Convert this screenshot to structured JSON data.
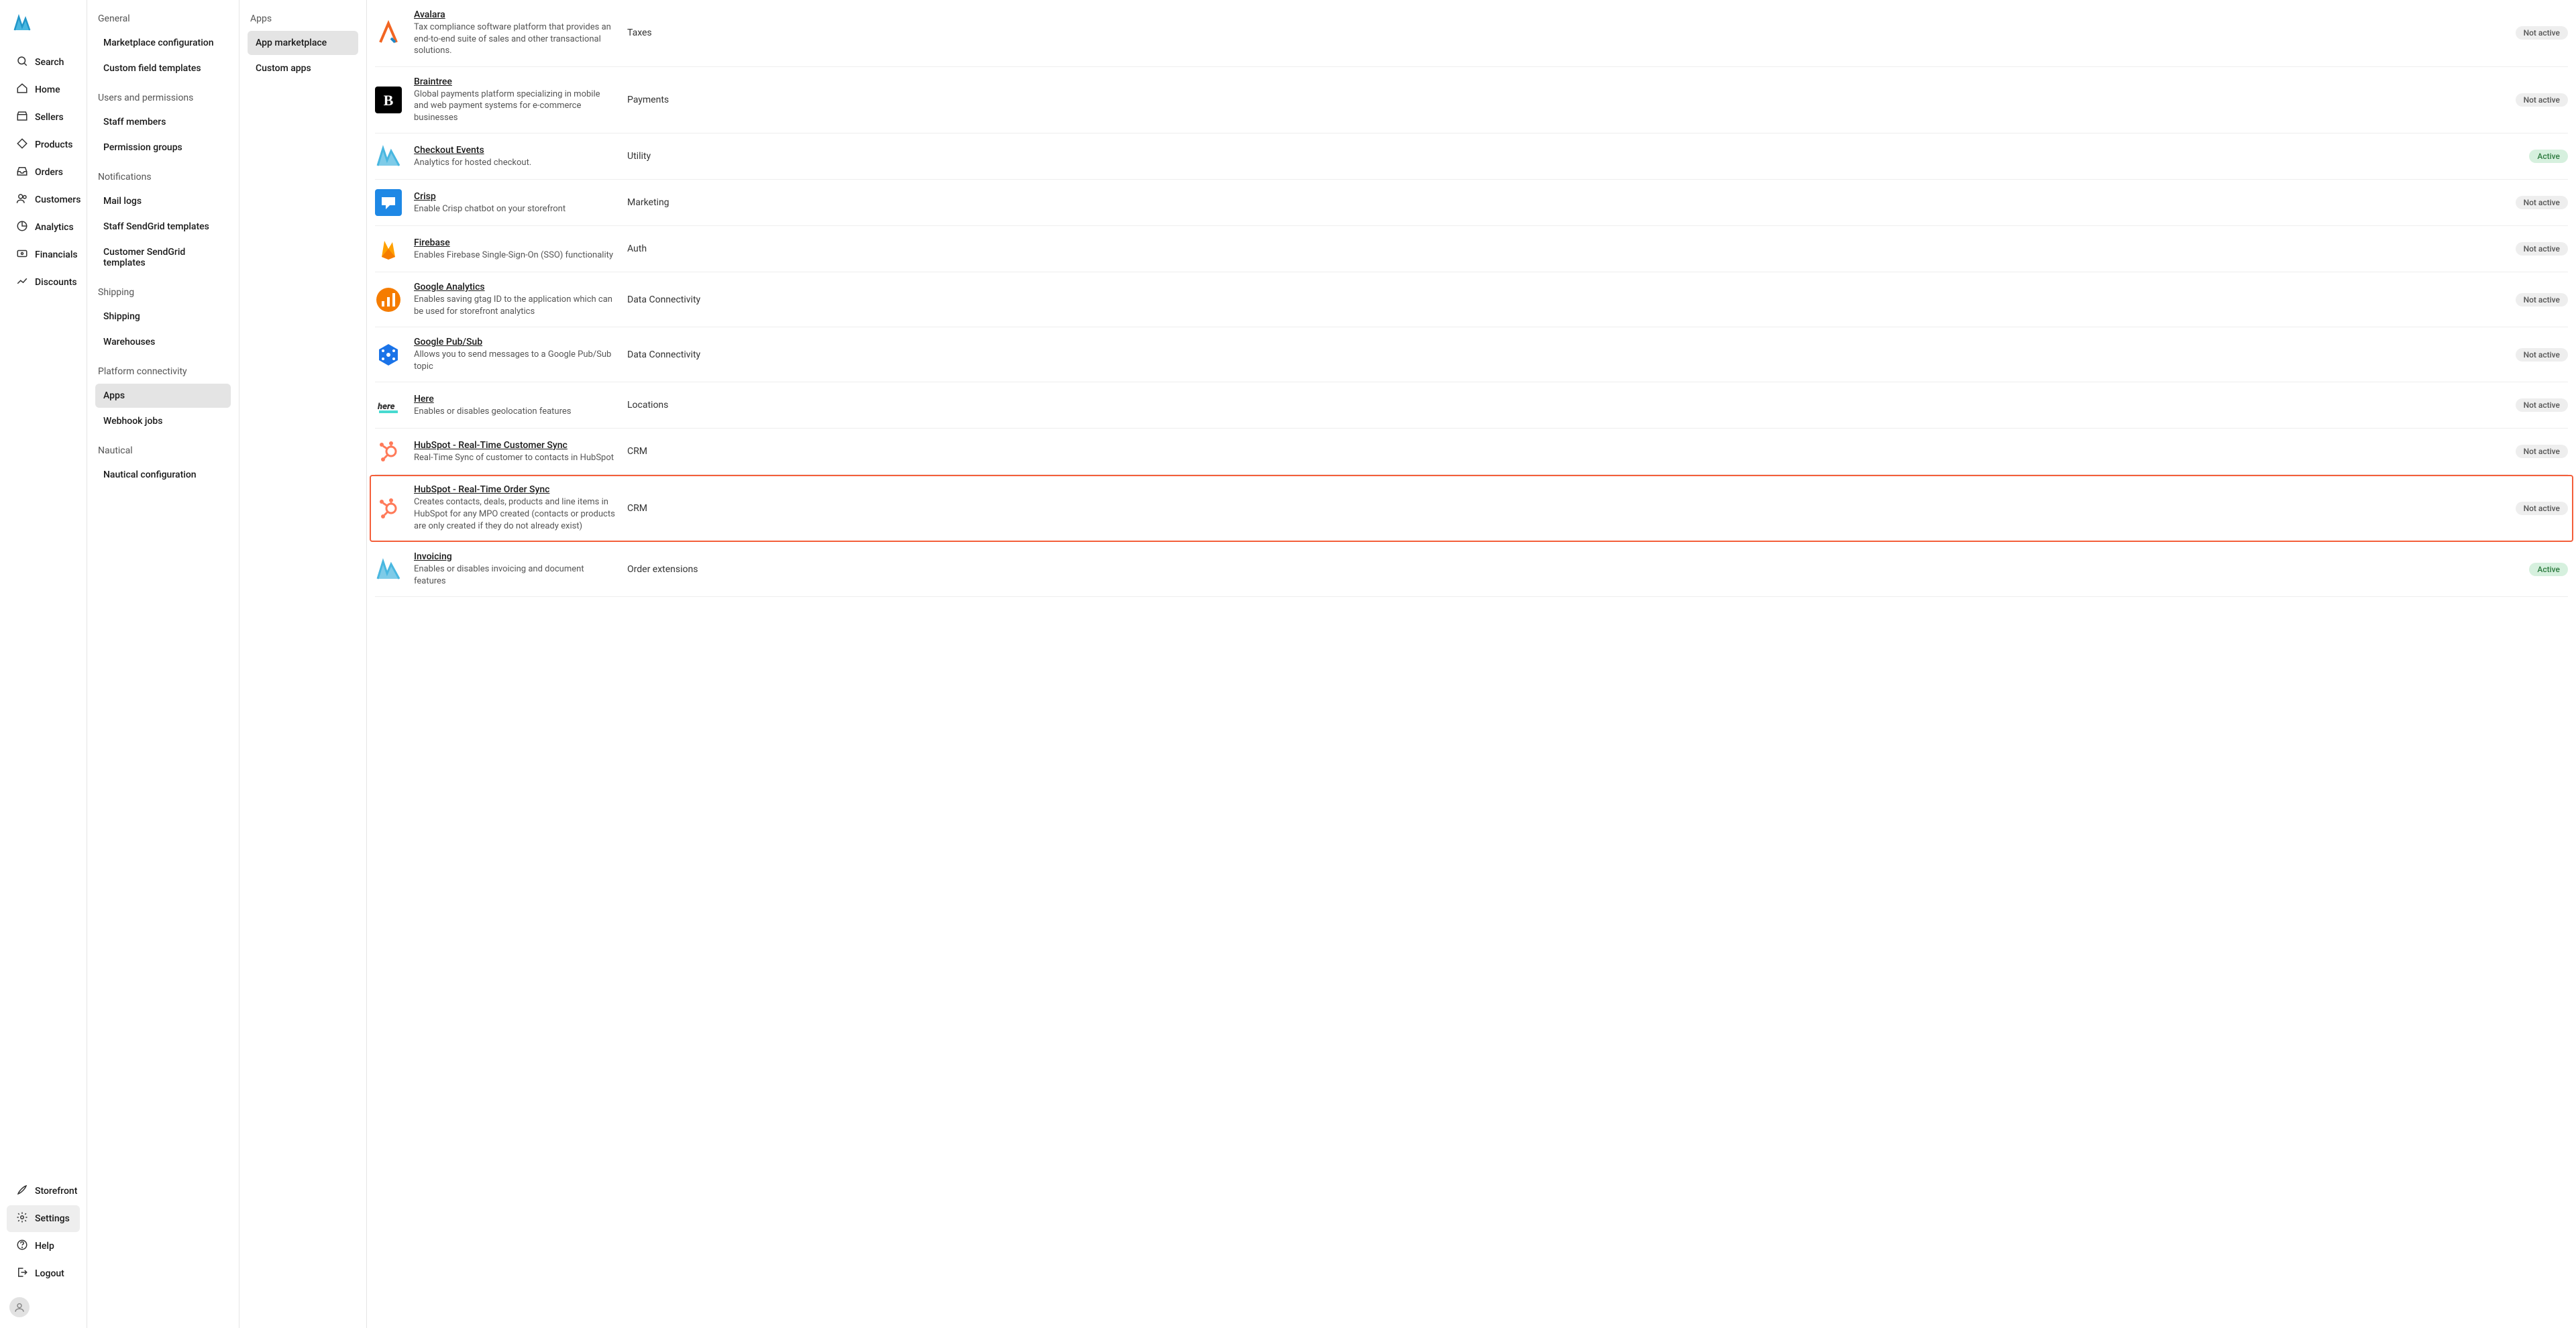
{
  "primary_nav": {
    "items": [
      {
        "label": "Search"
      },
      {
        "label": "Home"
      },
      {
        "label": "Sellers"
      },
      {
        "label": "Products"
      },
      {
        "label": "Orders"
      },
      {
        "label": "Customers"
      },
      {
        "label": "Analytics"
      },
      {
        "label": "Financials"
      },
      {
        "label": "Discounts"
      }
    ],
    "bottom": [
      {
        "label": "Storefront"
      },
      {
        "label": "Settings"
      },
      {
        "label": "Help"
      },
      {
        "label": "Logout"
      }
    ]
  },
  "settings_nav": {
    "groups": [
      {
        "heading": "General",
        "items": [
          "Marketplace configuration",
          "Custom field templates"
        ]
      },
      {
        "heading": "Users and permissions",
        "items": [
          "Staff members",
          "Permission groups"
        ]
      },
      {
        "heading": "Notifications",
        "items": [
          "Mail logs",
          "Staff SendGrid templates",
          "Customer SendGrid templates"
        ]
      },
      {
        "heading": "Shipping",
        "items": [
          "Shipping",
          "Warehouses"
        ]
      },
      {
        "heading": "Platform connectivity",
        "items": [
          "Apps",
          "Webhook jobs"
        ]
      },
      {
        "heading": "Nautical",
        "items": [
          "Nautical configuration"
        ]
      }
    ]
  },
  "apps_nav": {
    "heading": "Apps",
    "items": [
      "App marketplace",
      "Custom apps"
    ]
  },
  "app_list": [
    {
      "name": "Avalara",
      "desc": "Tax compliance software platform that provides an end-to-end suite of sales and other transactional solutions.",
      "category": "Taxes",
      "status": "Not active",
      "icon_color": "#f26522"
    },
    {
      "name": "Braintree",
      "desc": "Global payments platform specializing in mobile and web payment systems for e-commerce businesses",
      "category": "Payments",
      "status": "Not active",
      "icon_color": "#000000"
    },
    {
      "name": "Checkout Events",
      "desc": "Analytics for hosted checkout.",
      "category": "Utility",
      "status": "Active",
      "icon_color": "#3aa9e8"
    },
    {
      "name": "Crisp",
      "desc": "Enable Crisp chatbot on your storefront",
      "category": "Marketing",
      "status": "Not active",
      "icon_color": "#1e88e5"
    },
    {
      "name": "Firebase",
      "desc": "Enables Firebase Single-Sign-On (SSO) functionality",
      "category": "Auth",
      "status": "Not active",
      "icon_color": "#ffa000"
    },
    {
      "name": "Google Analytics",
      "desc": "Enables saving gtag ID to the application which can be used for storefront analytics",
      "category": "Data Connectivity",
      "status": "Not active",
      "icon_color": "#f57c00"
    },
    {
      "name": "Google Pub/Sub",
      "desc": "Allows you to send messages to a Google Pub/Sub topic",
      "category": "Data Connectivity",
      "status": "Not active",
      "icon_color": "#1a73e8"
    },
    {
      "name": "Here",
      "desc": "Enables or disables geolocation features",
      "category": "Locations",
      "status": "Not active",
      "icon_color": "#333333"
    },
    {
      "name": "HubSpot - Real-Time Customer Sync",
      "desc": "Real-Time Sync of customer to contacts in HubSpot",
      "category": "CRM",
      "status": "Not active",
      "icon_color": "#ff7a59"
    },
    {
      "name": "HubSpot - Real-Time Order Sync",
      "desc": "Creates contacts, deals, products and line items in HubSpot for any MPO created (contacts or products are only created if they do not already exist)",
      "category": "CRM",
      "status": "Not active",
      "icon_color": "#ff7a59",
      "highlight": true
    },
    {
      "name": "Invoicing",
      "desc": "Enables or disables invoicing and document features",
      "category": "Order extensions",
      "status": "Active",
      "icon_color": "#3aa9e8"
    }
  ]
}
